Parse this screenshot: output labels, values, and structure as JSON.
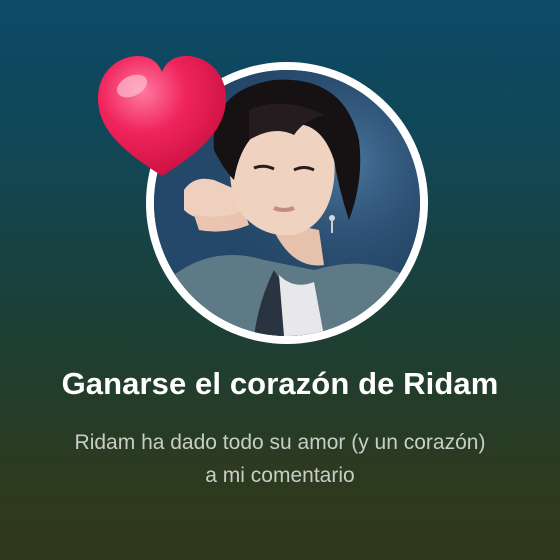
{
  "achievement": {
    "title": "Ganarse el corazón de Ridam",
    "description": "Ridam ha dado todo su amor (y un corazón) a mi comentario",
    "heart_color": "#f0245c",
    "ring_color": "#ffffff"
  },
  "icons": {
    "heart": "heart-icon",
    "avatar": "profile-photo"
  }
}
